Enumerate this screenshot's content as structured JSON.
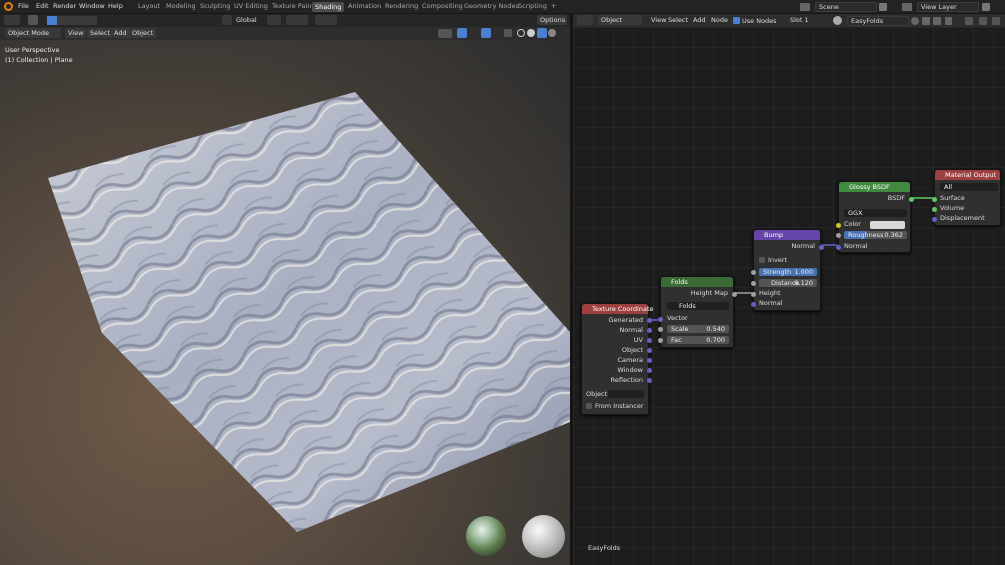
{
  "topbar": {
    "menu": [
      "File",
      "Edit",
      "Render",
      "Window",
      "Help"
    ],
    "workspaces": [
      "Layout",
      "Modeling",
      "Sculpting",
      "UV Editing",
      "Texture Paint",
      "Shading",
      "Animation",
      "Rendering",
      "Compositing",
      "Geometry Nodes",
      "Scripting"
    ],
    "active_workspace": "Shading",
    "scene": "Scene",
    "view_layer": "View Layer"
  },
  "vp_toolbar": {
    "orientation": "Global",
    "options": "Options"
  },
  "vp_header": {
    "mode": "Object Mode",
    "view": "View",
    "select": "Select",
    "add": "Add",
    "object": "Object"
  },
  "vp_overlay": {
    "perspective": "User Perspective",
    "collection": "(1) Collection | Plane"
  },
  "ne_header": {
    "type": "Object",
    "view": "View",
    "select": "Select",
    "add": "Add",
    "node": "Node",
    "use_nodes": "Use Nodes",
    "slot": "Slot 1",
    "material": "EasyFolds"
  },
  "ne_footer": "EasyFolds",
  "nodes": {
    "texcoord": {
      "title": "Texture Coordinate",
      "outputs": [
        "Generated",
        "Normal",
        "UV",
        "Object",
        "Camera",
        "Window",
        "Reflection"
      ],
      "object_label": "Object:",
      "from_instancer": "From Instancer"
    },
    "folds": {
      "title": "Folds",
      "out": "Height Map",
      "group": "Folds",
      "vector": "Vector",
      "scale_label": "Scale",
      "scale": "0.540",
      "fac_label": "Fac",
      "fac": "0.700"
    },
    "bump": {
      "title": "Bump",
      "out": "Normal",
      "invert": "Invert",
      "strength_label": "Strength",
      "strength": "1.000",
      "distance_label": "Distance",
      "distance": "0.120",
      "height": "Height",
      "normal": "Normal"
    },
    "glossy": {
      "title": "Glossy BSDF",
      "out": "BSDF",
      "dist": "GGX",
      "color": "Color",
      "roughness_label": "Roughness",
      "roughness": "0.362",
      "normal": "Normal"
    },
    "matout": {
      "title": "Material Output",
      "target": "All",
      "surface": "Surface",
      "volume": "Volume",
      "displacement": "Displacement"
    }
  },
  "colors": {
    "header_input": "#9b3f3f",
    "header_group": "#3a6a36",
    "header_vector": "#6546a8",
    "header_shader": "#3f8a3f",
    "sock_yellow": "#c7c729",
    "sock_purple": "#6363c7",
    "sock_gray": "#a1a1a1",
    "sock_green": "#63c763"
  }
}
